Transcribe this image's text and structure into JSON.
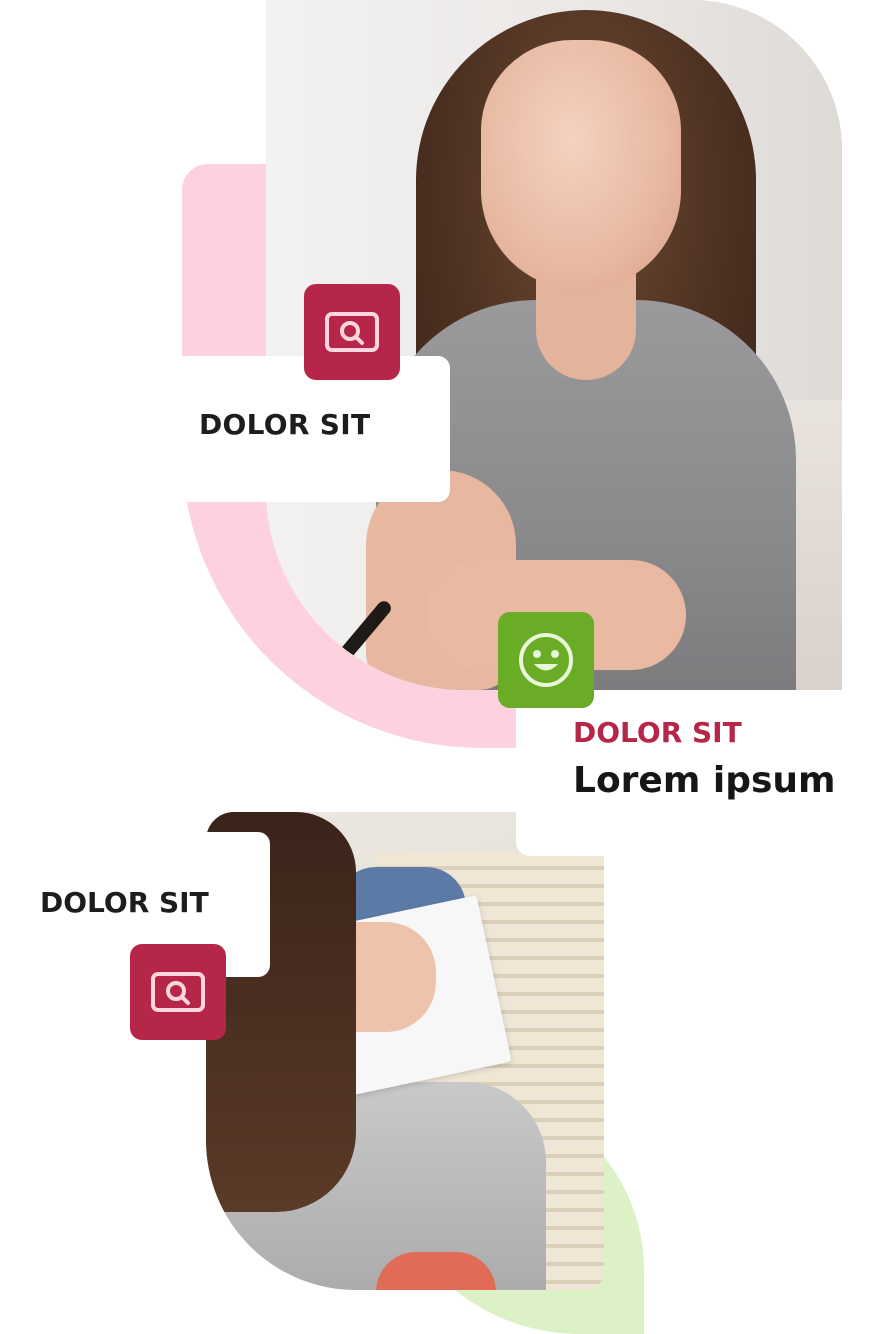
{
  "colors": {
    "accent_red": "#b62648",
    "accent_green": "#6aac25",
    "pink_shape": "#fdd1dd",
    "green_shape": "#ddf1c7"
  },
  "top_section": {
    "card_label": "DOLOR SIT",
    "card_icon": "search-window-icon",
    "badge_icon": "smiley-face-icon",
    "sub_label": "DOLOR SIT",
    "title": "Lorem ipsum"
  },
  "bottom_section": {
    "card_label": "DOLOR SIT",
    "card_icon": "search-window-icon"
  }
}
